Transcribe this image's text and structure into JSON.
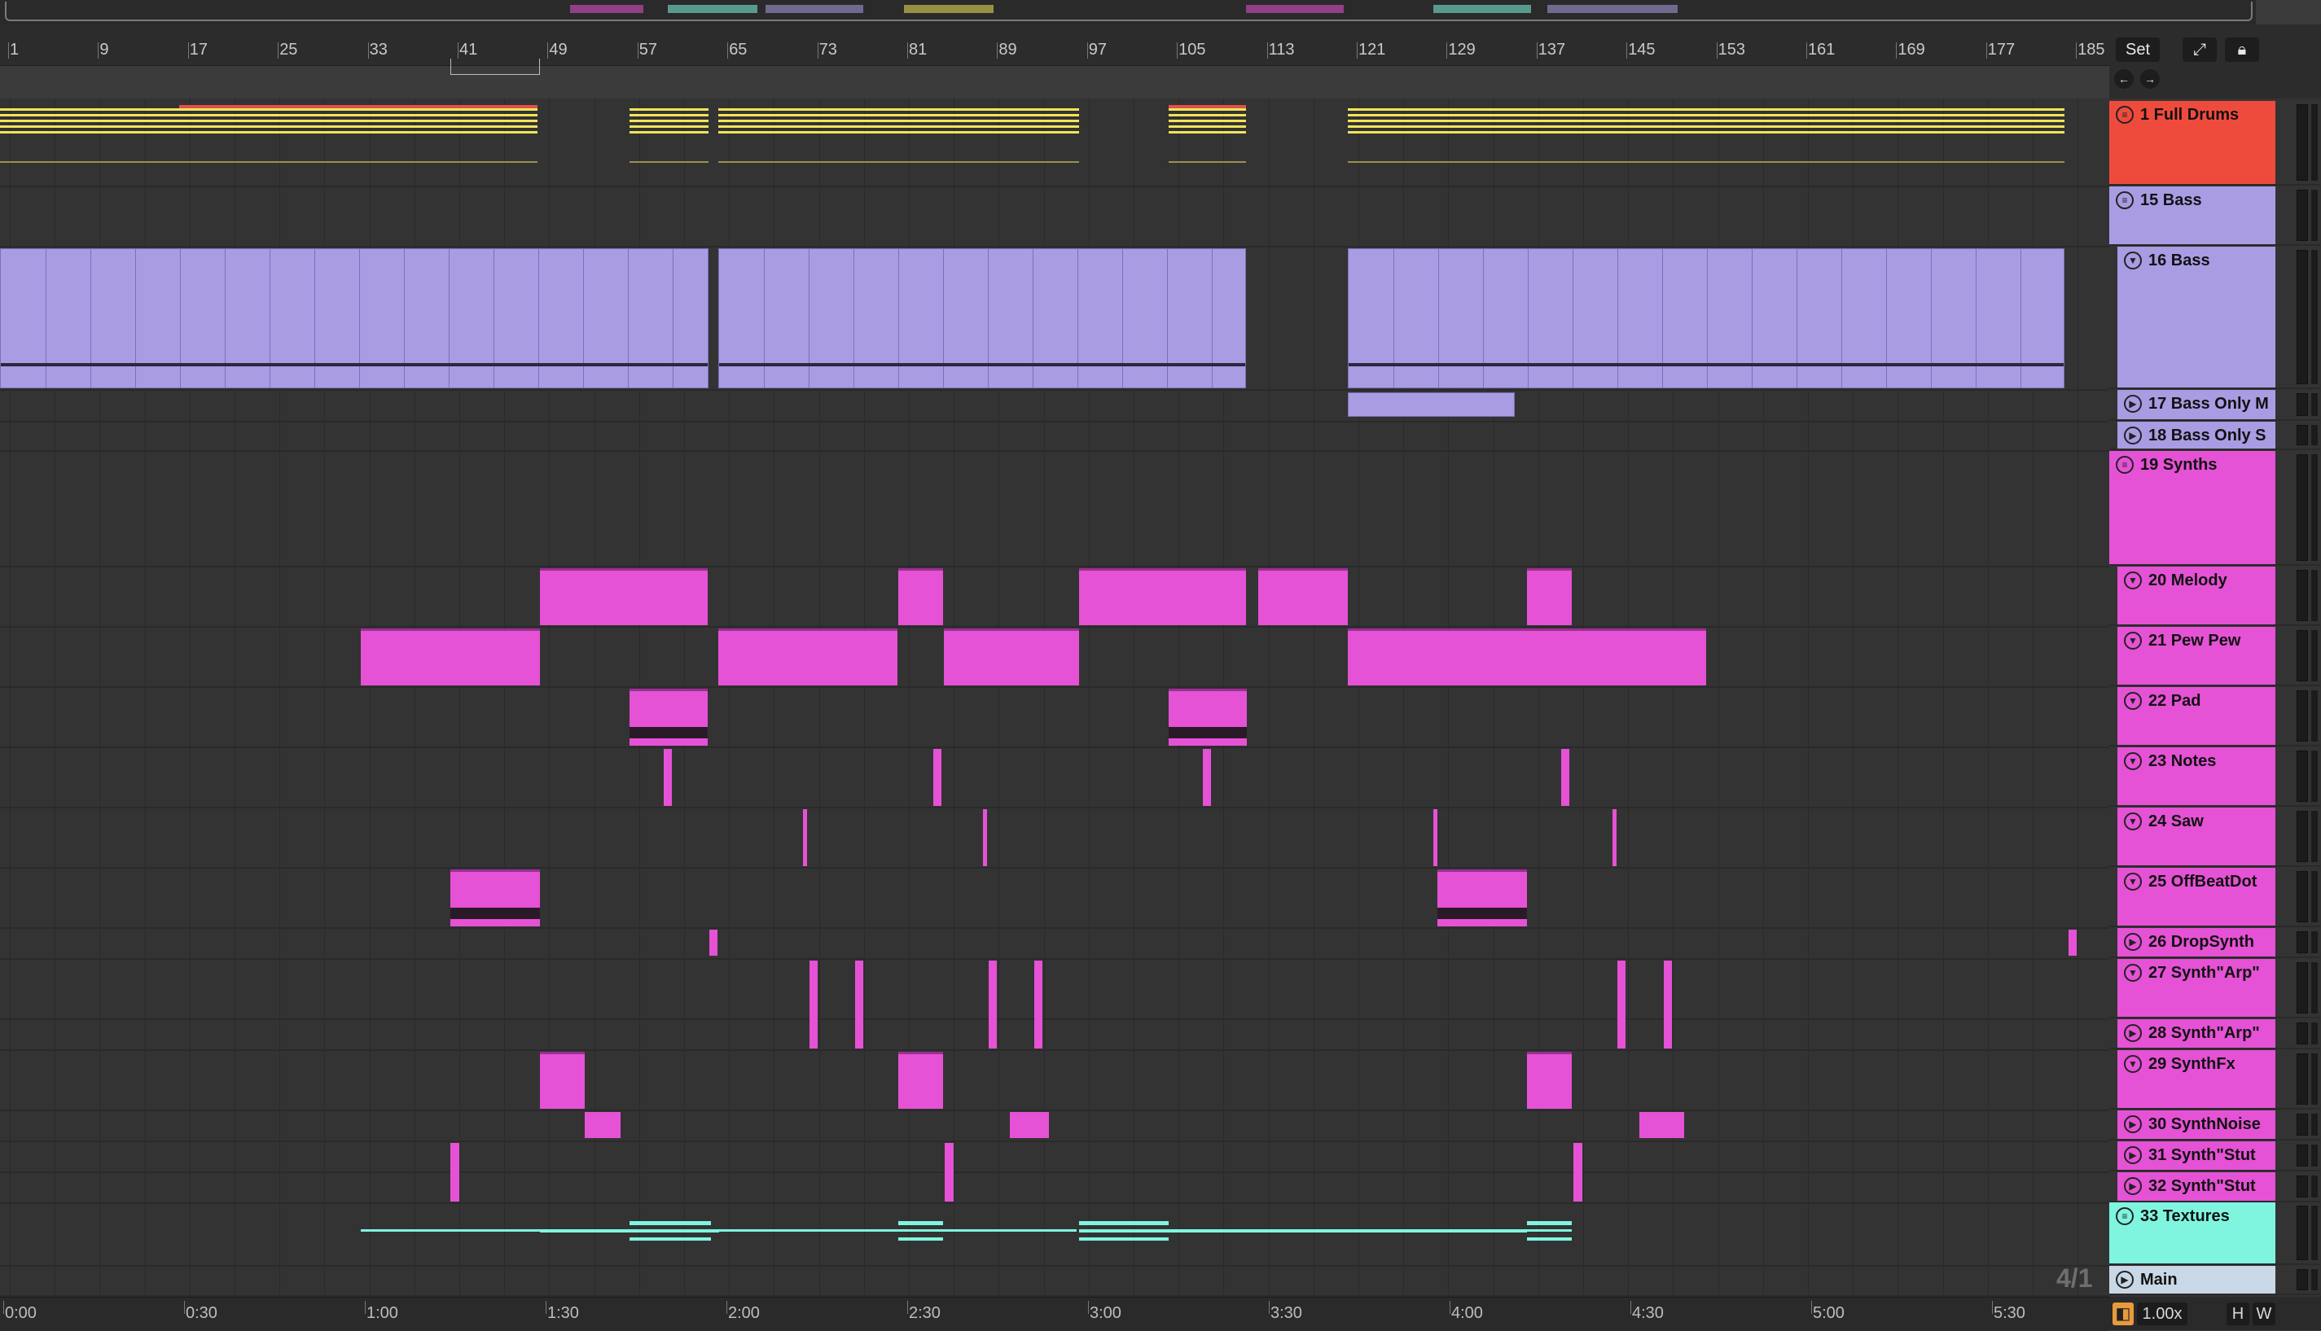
{
  "overview": {
    "label": ""
  },
  "ruler": {
    "bars": [
      "1",
      "9",
      "17",
      "25",
      "33",
      "41",
      "49",
      "57",
      "65",
      "73",
      "81",
      "89",
      "97",
      "105",
      "113",
      "121",
      "129",
      "137",
      "145",
      "153",
      "161",
      "169",
      "177",
      "185"
    ],
    "set_button": "Set",
    "expand_icon": "expand-icon",
    "lock_icon": "lock-icon",
    "nav_left_icon": "nav-back-icon",
    "nav_right_icon": "nav-forward-icon"
  },
  "time_ruler": {
    "labels": [
      "0:00",
      "0:30",
      "1:00",
      "1:30",
      "2:00",
      "2:30",
      "3:00",
      "3:30",
      "4:00",
      "4:30",
      "5:00",
      "5:30"
    ]
  },
  "time_signature": "4/1",
  "bottom": {
    "zoom_label": "1.00x",
    "h_button": "H",
    "w_button": "W"
  },
  "colors": {
    "drums": "#ef4b3d",
    "drums_clip": "#f0e35a",
    "bass": "#a99ce3",
    "synths": "#e552d5",
    "textures": "#7ff5e0",
    "main": "#c9d8e6"
  },
  "tracks": [
    {
      "name": "1 Full Drums",
      "type": "group",
      "color": "#ef4b3d"
    },
    {
      "name": "15 Bass",
      "type": "group",
      "color": "#a99ce3"
    },
    {
      "name": "16 Bass",
      "type": "track",
      "color": "#a99ce3"
    },
    {
      "name": "17 Bass Only M",
      "type": "track",
      "color": "#a99ce3"
    },
    {
      "name": "18 Bass Only S",
      "type": "track",
      "color": "#a99ce3"
    },
    {
      "name": "19 Synths",
      "type": "group",
      "color": "#e552d5"
    },
    {
      "name": "20 Melody",
      "type": "track",
      "color": "#e552d5"
    },
    {
      "name": "21 Pew Pew",
      "type": "track",
      "color": "#e552d5"
    },
    {
      "name": "22 Pad",
      "type": "track",
      "color": "#e552d5"
    },
    {
      "name": "23 Notes",
      "type": "track",
      "color": "#e552d5"
    },
    {
      "name": "24 Saw",
      "type": "track",
      "color": "#e552d5"
    },
    {
      "name": "25 OffBeatDot",
      "type": "track",
      "color": "#e552d5"
    },
    {
      "name": "26 DropSynth",
      "type": "track",
      "color": "#e552d5"
    },
    {
      "name": "27 Synth\"Arp\"",
      "type": "track",
      "color": "#e552d5"
    },
    {
      "name": "28 Synth\"Arp\"",
      "type": "track",
      "color": "#e552d5"
    },
    {
      "name": "29 SynthFx",
      "type": "track",
      "color": "#e552d5"
    },
    {
      "name": "30 SynthNoise",
      "type": "track",
      "color": "#e552d5"
    },
    {
      "name": "31 Synth\"Stut",
      "type": "track",
      "color": "#e552d5"
    },
    {
      "name": "32 Synth\"Stut",
      "type": "track",
      "color": "#e552d5"
    },
    {
      "name": "33 Textures",
      "type": "group",
      "color": "#7ff5e0"
    },
    {
      "name": "Main",
      "type": "main",
      "color": "#c9d8e6"
    }
  ]
}
